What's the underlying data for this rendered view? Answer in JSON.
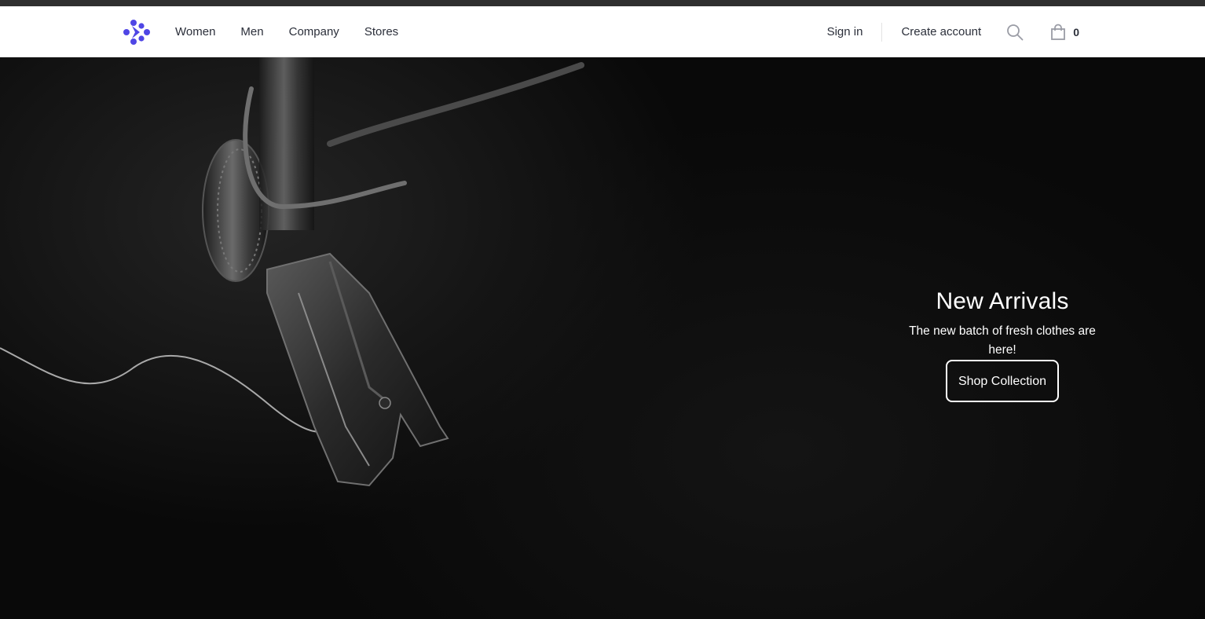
{
  "brand": {
    "logo_icon": "dots-cross-logo-icon",
    "accent_color": "#4f46e5"
  },
  "nav": {
    "items": [
      {
        "label": "Women"
      },
      {
        "label": "Men"
      },
      {
        "label": "Company"
      },
      {
        "label": "Stores"
      }
    ]
  },
  "account": {
    "sign_in": "Sign in",
    "create_account": "Create account",
    "search_icon": "search-icon",
    "cart_icon": "shopping-bag-icon",
    "cart_count": "0"
  },
  "hero": {
    "title": "New Arrivals",
    "subtitle": "The new batch of fresh clothes are here!",
    "cta_label": "Shop Collection",
    "background_image": "sewing-machine-needle-on-dark-fabric"
  }
}
